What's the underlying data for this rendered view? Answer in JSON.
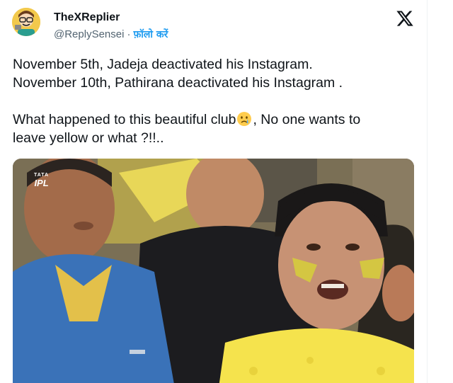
{
  "author": {
    "display_name": "TheXReplier",
    "handle": "@ReplySensei",
    "separator": "·",
    "follow_label": "फ़ॉलो करें"
  },
  "tweet": {
    "line1": "November 5th, Jadeja deactivated his Instagram.",
    "line2": "November 10th, Pathirana deactivated his Instagram .",
    "line3_before_emoji": "What happened to this beautiful club",
    "line3_after_emoji": ", No one wants to",
    "line4": "leave yellow or what ?!!..",
    "emoji": "crying-face-emoji"
  },
  "media": {
    "watermark_top": "TATA",
    "watermark_main": "IPL"
  },
  "colors": {
    "accent": "#1d9bf0",
    "text": "#0f1419",
    "secondary": "#536471"
  },
  "icons": {
    "platform_logo": "x-logo-icon"
  }
}
